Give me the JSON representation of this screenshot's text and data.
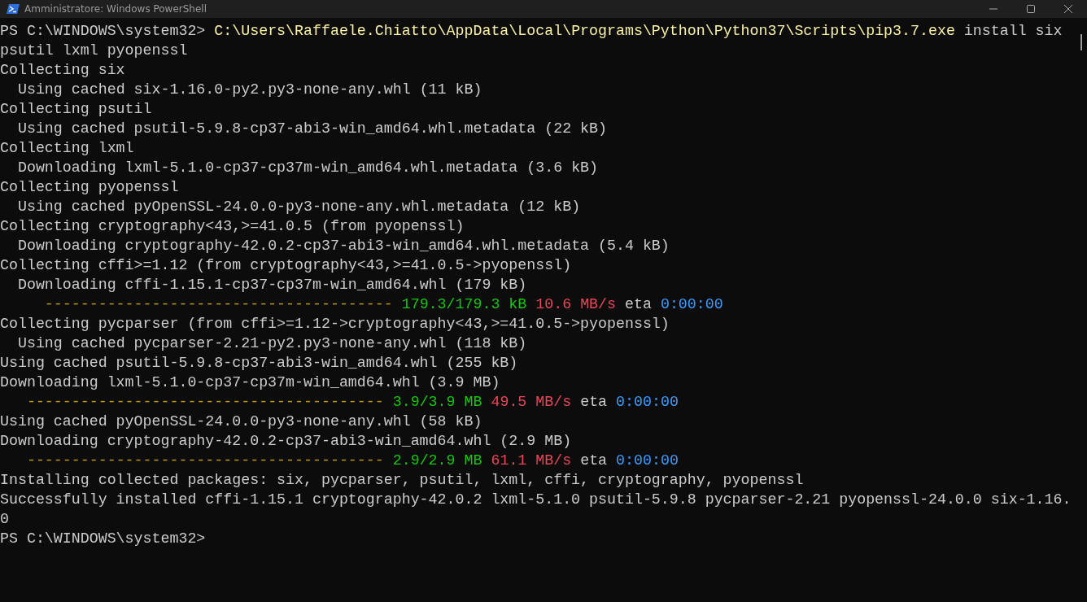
{
  "window": {
    "title": "Amministratore: Windows PowerShell"
  },
  "lines": [
    [
      {
        "kind": "prompt",
        "text": "PS C:\\WINDOWS\\system32> "
      },
      {
        "kind": "command",
        "text": "C:\\Users\\Raffaele.Chiatto\\AppData\\Local\\Programs\\Python\\Python37\\Scripts\\pip3.7.exe"
      },
      {
        "kind": "text",
        "text": " install six"
      }
    ],
    [
      {
        "kind": "text",
        "text": "psutil lxml pyopenssl"
      }
    ],
    [
      {
        "kind": "text",
        "text": "Collecting six"
      }
    ],
    [
      {
        "kind": "text",
        "text": "  Using cached six-1.16.0-py2.py3-none-any.whl (11 kB)"
      }
    ],
    [
      {
        "kind": "text",
        "text": "Collecting psutil"
      }
    ],
    [
      {
        "kind": "text",
        "text": "  Using cached psutil-5.9.8-cp37-abi3-win_amd64.whl.metadata (22 kB)"
      }
    ],
    [
      {
        "kind": "text",
        "text": "Collecting lxml"
      }
    ],
    [
      {
        "kind": "text",
        "text": "  Downloading lxml-5.1.0-cp37-cp37m-win_amd64.whl.metadata (3.6 kB)"
      }
    ],
    [
      {
        "kind": "text",
        "text": "Collecting pyopenssl"
      }
    ],
    [
      {
        "kind": "text",
        "text": "  Using cached pyOpenSSL-24.0.0-py3-none-any.whl.metadata (12 kB)"
      }
    ],
    [
      {
        "kind": "text",
        "text": "Collecting cryptography<43,>=41.0.5 (from pyopenssl)"
      }
    ],
    [
      {
        "kind": "text",
        "text": "  Downloading cryptography-42.0.2-cp37-abi3-win_amd64.whl.metadata (5.4 kB)"
      }
    ],
    [
      {
        "kind": "text",
        "text": "Collecting cffi>=1.12 (from cryptography<43,>=41.0.5->pyopenssl)"
      }
    ],
    [
      {
        "kind": "text",
        "text": "  Downloading cffi-1.15.1-cp37-cp37m-win_amd64.whl (179 kB)"
      }
    ],
    [
      {
        "kind": "bar",
        "text": "     --------------------------------------- "
      },
      {
        "kind": "size",
        "text": "179.3/179.3 kB "
      },
      {
        "kind": "speed",
        "text": "10.6 MB/s"
      },
      {
        "kind": "text",
        "text": " eta "
      },
      {
        "kind": "eta",
        "text": "0:00:00"
      }
    ],
    [
      {
        "kind": "text",
        "text": "Collecting pycparser (from cffi>=1.12->cryptography<43,>=41.0.5->pyopenssl)"
      }
    ],
    [
      {
        "kind": "text",
        "text": "  Using cached pycparser-2.21-py2.py3-none-any.whl (118 kB)"
      }
    ],
    [
      {
        "kind": "text",
        "text": "Using cached psutil-5.9.8-cp37-abi3-win_amd64.whl (255 kB)"
      }
    ],
    [
      {
        "kind": "text",
        "text": "Downloading lxml-5.1.0-cp37-cp37m-win_amd64.whl (3.9 MB)"
      }
    ],
    [
      {
        "kind": "bar",
        "text": "   ---------------------------------------- "
      },
      {
        "kind": "size",
        "text": "3.9/3.9 MB "
      },
      {
        "kind": "speed",
        "text": "49.5 MB/s"
      },
      {
        "kind": "text",
        "text": " eta "
      },
      {
        "kind": "eta",
        "text": "0:00:00"
      }
    ],
    [
      {
        "kind": "text",
        "text": "Using cached pyOpenSSL-24.0.0-py3-none-any.whl (58 kB)"
      }
    ],
    [
      {
        "kind": "text",
        "text": "Downloading cryptography-42.0.2-cp37-abi3-win_amd64.whl (2.9 MB)"
      }
    ],
    [
      {
        "kind": "bar",
        "text": "   ---------------------------------------- "
      },
      {
        "kind": "size",
        "text": "2.9/2.9 MB "
      },
      {
        "kind": "speed",
        "text": "61.1 MB/s"
      },
      {
        "kind": "text",
        "text": " eta "
      },
      {
        "kind": "eta",
        "text": "0:00:00"
      }
    ],
    [
      {
        "kind": "text",
        "text": "Installing collected packages: six, pycparser, psutil, lxml, cffi, cryptography, pyopenssl"
      }
    ],
    [
      {
        "kind": "text",
        "text": "Successfully installed cffi-1.15.1 cryptography-42.0.2 lxml-5.1.0 psutil-5.9.8 pycparser-2.21 pyopenssl-24.0.0 six-1.16."
      }
    ],
    [
      {
        "kind": "text",
        "text": "0"
      }
    ],
    [
      {
        "kind": "prompt",
        "text": "PS C:\\WINDOWS\\system32>"
      }
    ]
  ]
}
